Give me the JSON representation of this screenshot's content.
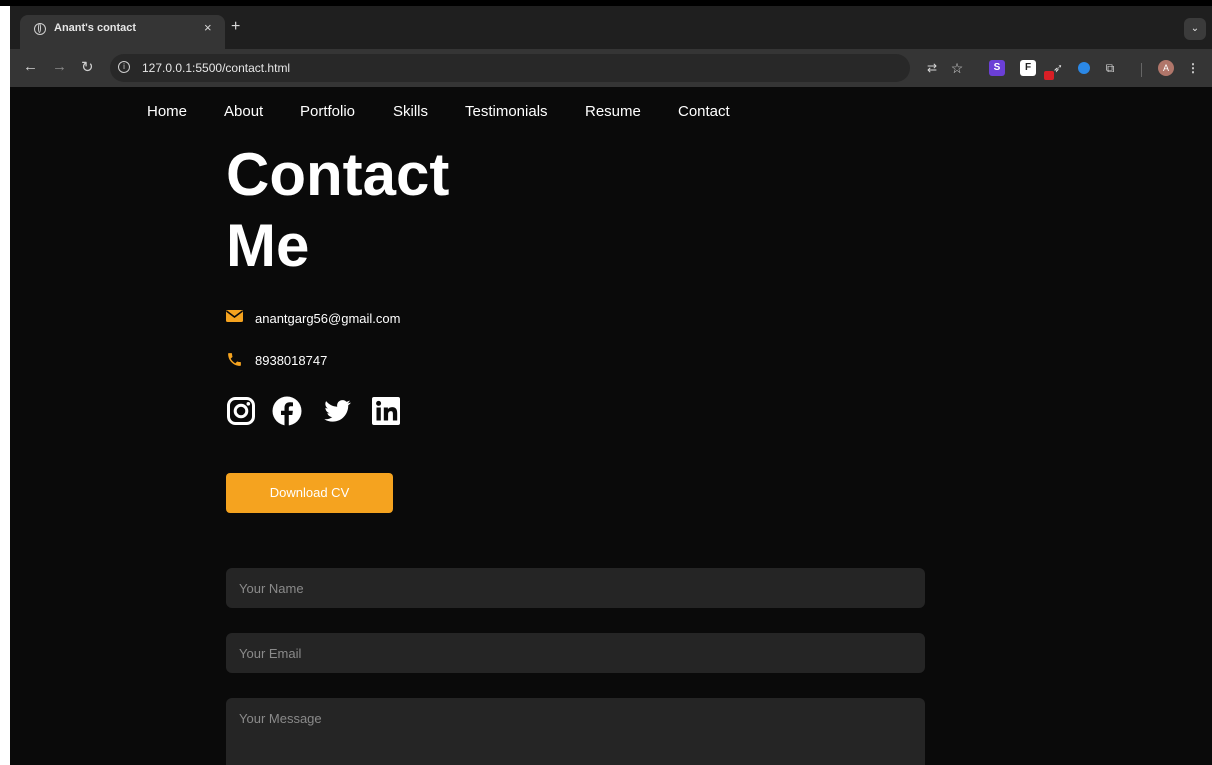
{
  "browser": {
    "tab_title": "Anant's contact",
    "tab_close": "×",
    "new_tab": "+",
    "tab_menu": "⌄",
    "url": "127.0.0.1:5500/contact.html",
    "avatar_letter": "A",
    "ext_s_label": "S",
    "ext_f_label": "F"
  },
  "nav": {
    "items": [
      "Home",
      "About",
      "Portfolio",
      "Skills",
      "Testimonials",
      "Resume",
      "Contact"
    ]
  },
  "contact": {
    "heading_line1": "Contact",
    "heading_line2": "Me",
    "email": "anantgarg56@gmail.com",
    "phone": "8938018747",
    "download_label": "Download CV",
    "accent_color": "#f5a31f",
    "socials": [
      "instagram-icon",
      "facebook-icon",
      "twitter-icon",
      "linkedin-icon"
    ]
  },
  "form": {
    "name_placeholder": "Your Name",
    "email_placeholder": "Your Email",
    "message_placeholder": "Your Message"
  }
}
